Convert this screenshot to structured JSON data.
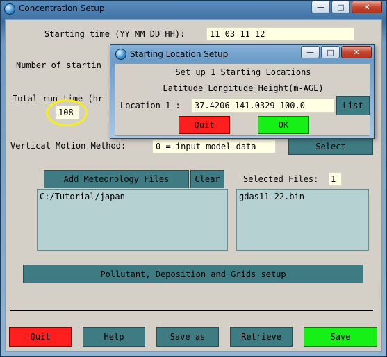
{
  "main_window": {
    "title": "Concentration Setup",
    "starting_time": {
      "label": "Starting time (YY MM DD HH):",
      "value": "11 03 11 12"
    },
    "number_of_starting": {
      "label": "Number of startin"
    },
    "total_run_time": {
      "label": "Total run time (hr",
      "value": "108"
    },
    "vertical_motion": {
      "label": "Vertical Motion Method:",
      "value": "0 = input model data",
      "select_label": "Select"
    },
    "meteorology": {
      "add_label": "Add Meteorology Files",
      "clear_label": "Clear",
      "selected_label": "Selected Files:",
      "selected_count": "1",
      "directory": "C:/Tutorial/japan",
      "files": [
        "gdas11-22.bin"
      ]
    },
    "pollutant_button": "Pollutant, Deposition and Grids setup",
    "bottom_buttons": {
      "quit": "Quit",
      "help": "Help",
      "save_as": "Save as",
      "retrieve": "Retrieve",
      "save": "Save"
    }
  },
  "dialog": {
    "title": "Starting Location Setup",
    "heading": "Set up 1 Starting Locations",
    "subheading": "Latitude Longitude Height(m-AGL)",
    "location_label": "Location 1 :",
    "location_value": "37.4206 141.0329 100.0",
    "list_label": "List",
    "quit_label": "Quit",
    "ok_label": "OK"
  },
  "icons": [
    "hysplit-globe-icon",
    "minimize-icon",
    "maximize-icon",
    "close-icon"
  ],
  "colors": {
    "quit": "#ff1f1f",
    "ok_save": "#16f016",
    "button": "#3f7b82",
    "input_bg": "#ffffe4",
    "listbox_bg": "#b6d1d1",
    "highlight_ring": "#f5ee18"
  }
}
